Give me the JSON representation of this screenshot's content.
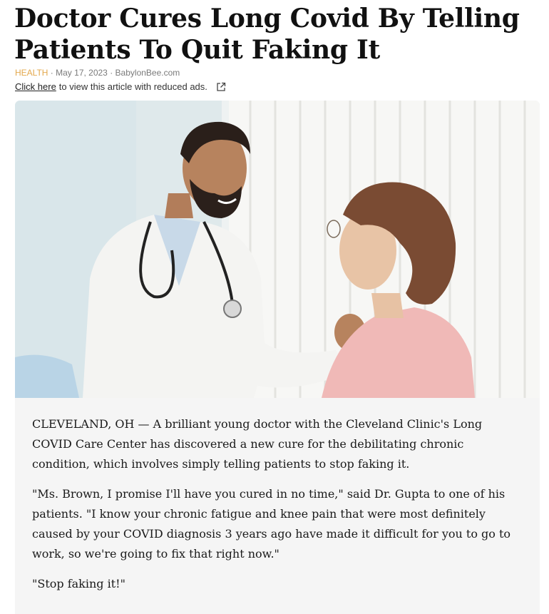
{
  "article": {
    "title": "Doctor Cures Long Covid By Telling Patients To Quit Faking It",
    "category": "HEALTH",
    "date": "May 17, 2023",
    "source": "BabylonBee.com",
    "reduced_ads_link": "Click here",
    "reduced_ads_text": "to view this article with reduced ads.",
    "paragraphs": [
      "CLEVELAND, OH — A brilliant young doctor with the Cleveland Clinic's Long COVID Care Center has discovered a new cure for the debilitating chronic condition, which involves simply telling patients to stop faking it.",
      "\"Ms. Brown, I promise I'll have you cured in no time,\" said Dr. Gupta to one of his patients. \"I know your chronic fatigue and knee pain that were most definitely caused by your COVID diagnosis 3 years ago have made it difficult for you to go to work, so we're going to fix that right now.\"",
      "\"Stop faking it!\""
    ]
  },
  "icons": {
    "external": "external-link-icon"
  },
  "colors": {
    "category": "#e3a84d",
    "meta": "#7a7a7a",
    "card_bg": "#f5f5f5"
  }
}
